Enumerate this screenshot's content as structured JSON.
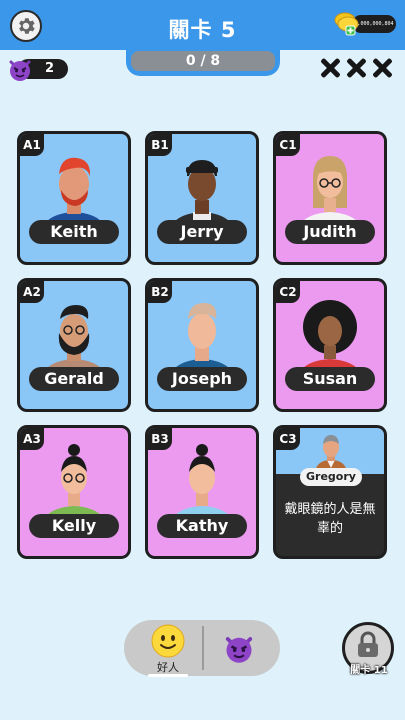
{
  "header": {
    "title": "關卡 5",
    "progress": "0 / 8",
    "coins": "1,000,000,804"
  },
  "villain_count": "2",
  "strikes": 3,
  "cards": [
    {
      "tag": "A1",
      "name": "Keith",
      "color": "blue"
    },
    {
      "tag": "B1",
      "name": "Jerry",
      "color": "blue"
    },
    {
      "tag": "C1",
      "name": "Judith",
      "color": "pink"
    },
    {
      "tag": "A2",
      "name": "Gerald",
      "color": "blue"
    },
    {
      "tag": "B2",
      "name": "Joseph",
      "color": "blue"
    },
    {
      "tag": "C2",
      "name": "Susan",
      "color": "pink"
    },
    {
      "tag": "A3",
      "name": "Kelly",
      "color": "pink"
    },
    {
      "tag": "B3",
      "name": "Kathy",
      "color": "pink"
    }
  ],
  "clue_card": {
    "tag": "C3",
    "name": "Gregory",
    "clue": "戴眼鏡的人是無辜的"
  },
  "bottom": {
    "good_label": "好人",
    "lock_label": "關卡 11"
  },
  "colors": {
    "blue_card": "#8ac6f6",
    "pink_card": "#ec9af0",
    "topbar": "#3b97e9"
  }
}
